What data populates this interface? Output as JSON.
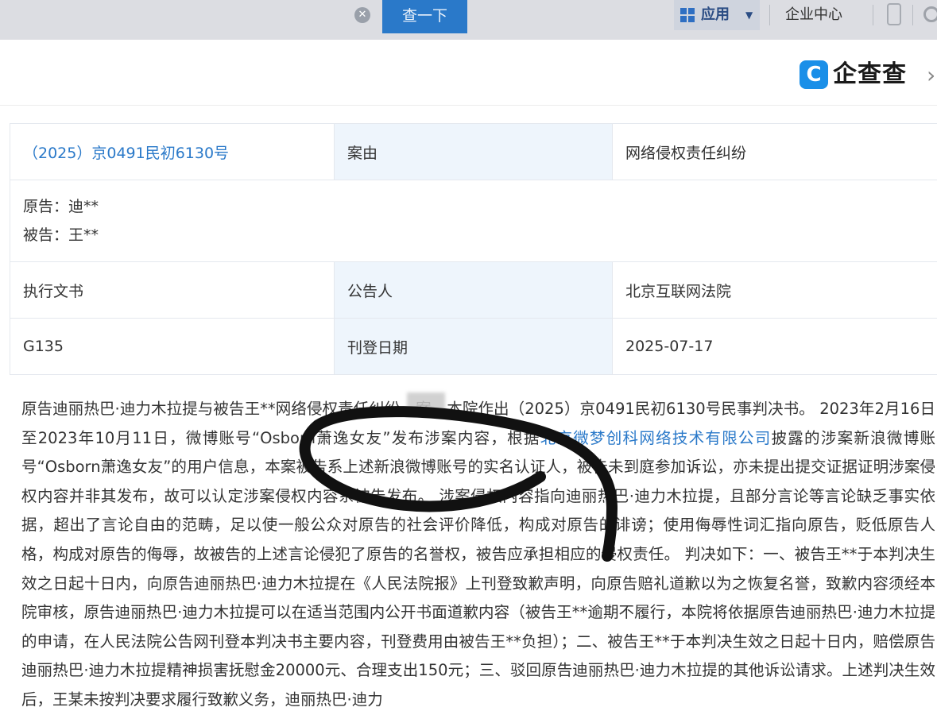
{
  "topbar": {
    "search_button": "查一下",
    "apps_label": "应用",
    "enterprise_center": "企业中心"
  },
  "brand": {
    "name": "企查查",
    "accent": "#1a8fe8"
  },
  "case": {
    "case_number": "（2025）京0491民初6130号",
    "cause_label": "案由",
    "cause_value": "网络侵权责任纠纷",
    "plaintiff": "原告：迪**",
    "defendant": "被告：王**",
    "doc_type": "执行文书",
    "announcer_label": "公告人",
    "announcer_value": "北京互联网法院",
    "code": "G135",
    "publish_date_label": "刊登日期",
    "publish_date_value": "2025-07-17"
  },
  "content": {
    "part1": "原告迪丽热巴·迪力木拉提与被告王**网络侵权责任纠纷一案，本院作出（2025）京0491民初6130号民事判决书。 2023年2月16日至2023年10月11日，微博账号“Osborn萧逸女友”发布涉案内容，根据",
    "link": "北京微梦创科网络技术有限公司",
    "part2": "披露的涉案新浪微博账号“Osborn萧逸女友”的用户信息，本案被告系上述新浪微博账号的实名认证人，被告未到庭参加诉讼，亦未提出提交证据证明涉案侵权内容并非其发布，故可以认定涉案侵权内容系被告发布。 涉案侵权内容指向迪丽热巴·迪力木拉提，且部分言论等言论缺乏事实依据，超出了言论自由的范畴，足以使一般公众对原告的社会评价降低，构成对原告的诽谤；使用侮辱性词汇指向原告，贬低原告人格，构成对原告的侮辱，故被告的上述言论侵犯了原告的名誉权，被告应承担相应的侵权责任。 判决如下：一、被告王**于本判决生效之日起十日内，向原告迪丽热巴·迪力木拉提在《人民法院报》上刊登致歉声明，向原告赔礼道歉以为之恢复名誉，致歉内容须经本院审核，原告迪丽热巴·迪力木拉提可以在适当范围内公开书面道歉内容（被告王**逾期不履行，本院将依据原告迪丽热巴·迪力木拉提的申请，在人民法院公告网刊登本判决书主要内容，刊登费用由被告王**负担）；二、被告王**于本判决生效之日起十日内，赔偿原告迪丽热巴·迪力木拉提精神损害抚慰金20000元、合理支出150元；三、驳回原告迪丽热巴·迪力木拉提的其他诉讼请求。上述判决生效后，王某未按判决要求履行致歉义务，迪丽热巴·迪力"
  }
}
